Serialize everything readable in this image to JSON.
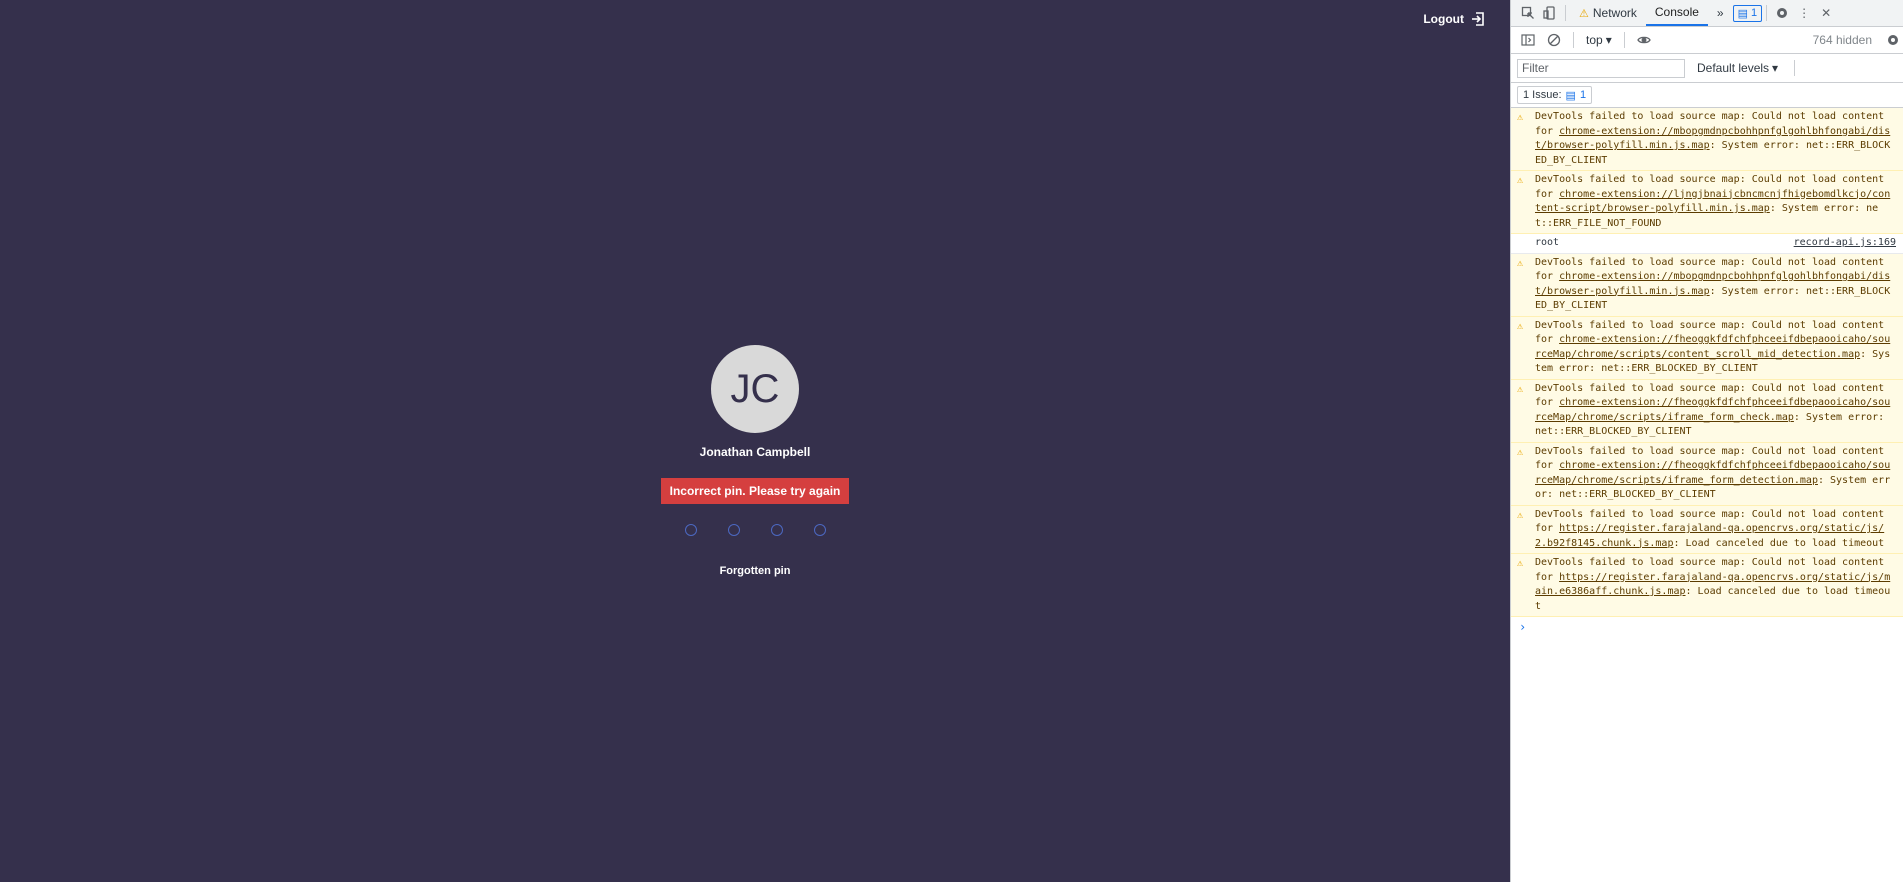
{
  "app": {
    "logout_label": "Logout",
    "avatar_initials": "JC",
    "user_name": "Jonathan Campbell",
    "error_message": "Incorrect pin. Please try again",
    "pin_length": 4,
    "forgot_pin_label": "Forgotten pin"
  },
  "devtools": {
    "tabs": {
      "network": "Network",
      "console": "Console",
      "more": "»",
      "messages_count": "1"
    },
    "toolbar": {
      "context": "top",
      "hidden": "764 hidden"
    },
    "filter": {
      "placeholder": "Filter",
      "levels": "Default levels"
    },
    "issues": {
      "label": "1 Issue:",
      "count": "1"
    },
    "log": [
      {
        "type": "warning",
        "prefix": "DevTools failed to load source map: Could not load content for ",
        "link": "chrome-extension://mbopgmdnpcbohhpnfglgohlbhfongabi/dist/browser-polyfill.min.js.map",
        "suffix": ": System error: net::ERR_BLOCKED_BY_CLIENT"
      },
      {
        "type": "warning",
        "prefix": "DevTools failed to load source map: Could not load content for ",
        "link": "chrome-extension://ljngjbnaijcbncmcnjfhigebomdlkcjo/content-script/browser-polyfill.min.js.map",
        "suffix": ": System error: net::ERR_FILE_NOT_FOUND"
      },
      {
        "type": "info",
        "prefix": "root",
        "link": "",
        "suffix": "",
        "source": "record-api.js:169"
      },
      {
        "type": "warning",
        "prefix": "DevTools failed to load source map: Could not load content for ",
        "link": "chrome-extension://mbopgmdnpcbohhpnfglgohlbhfongabi/dist/browser-polyfill.min.js.map",
        "suffix": ": System error: net::ERR_BLOCKED_BY_CLIENT"
      },
      {
        "type": "warning",
        "prefix": "DevTools failed to load source map: Could not load content for ",
        "link": "chrome-extension://fheoggkfdfchfphceeifdbepaooicaho/sourceMap/chrome/scripts/content_scroll_mid_detection.map",
        "suffix": ": System error: net::ERR_BLOCKED_BY_CLIENT"
      },
      {
        "type": "warning",
        "prefix": "DevTools failed to load source map: Could not load content for ",
        "link": "chrome-extension://fheoggkfdfchfphceeifdbepaooicaho/sourceMap/chrome/scripts/iframe_form_check.map",
        "suffix": ": System error: net::ERR_BLOCKED_BY_CLIENT"
      },
      {
        "type": "warning",
        "prefix": "DevTools failed to load source map: Could not load content for ",
        "link": "chrome-extension://fheoggkfdfchfphceeifdbepaooicaho/sourceMap/chrome/scripts/iframe_form_detection.map",
        "suffix": ": System error: net::ERR_BLOCKED_BY_CLIENT"
      },
      {
        "type": "warning",
        "prefix": "DevTools failed to load source map: Could not load content for ",
        "link": "https://register.farajaland-qa.opencrvs.org/static/js/2.b92f8145.chunk.js.map",
        "suffix": ": Load canceled due to load timeout"
      },
      {
        "type": "warning",
        "prefix": "DevTools failed to load source map: Could not load content for ",
        "link": "https://register.farajaland-qa.opencrvs.org/static/js/main.e6386aff.chunk.js.map",
        "suffix": ": Load canceled due to load timeout"
      }
    ],
    "prompt": "›"
  },
  "colors": {
    "app_bg": "#35304c",
    "error": "#d53f3f",
    "pin_dot": "#4c68c1",
    "warning_bg": "#fffbe5"
  }
}
